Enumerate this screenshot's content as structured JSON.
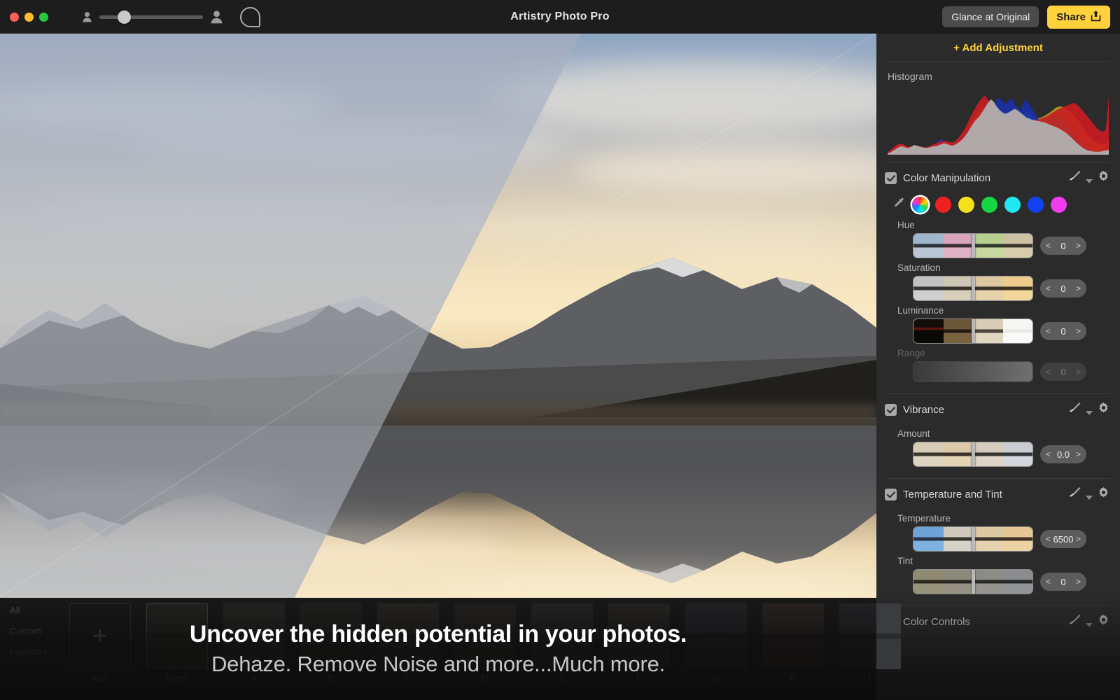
{
  "window": {
    "title": "Artistry Photo Pro",
    "traffic_lights": [
      "close",
      "minimize",
      "maximize"
    ],
    "zoom_slider": {
      "icon_small": "person-small-icon",
      "icon_large": "person-large-icon",
      "value_pct": 18
    },
    "brush_tool_icon": "brush-circle-icon",
    "glance_button": "Glance at Original",
    "share_button": "Share",
    "share_icon": "share-icon"
  },
  "panel": {
    "add_adjustment": "+ Add Adjustment",
    "histogram_label": "Histogram",
    "sections": [
      {
        "title": "Color Manipulation",
        "checked": true,
        "brush_icon": "brush-icon",
        "caret_icon": "chevron-down-icon",
        "gear_icon": "gear-icon",
        "eyedropper_icon": "eyedropper-icon",
        "swatches": [
          {
            "name": "color-wheel",
            "color": "conic",
            "selected": true
          },
          {
            "name": "red",
            "color": "#ef2020",
            "selected": false
          },
          {
            "name": "yellow",
            "color": "#f5e01a",
            "selected": false
          },
          {
            "name": "green",
            "color": "#16d743",
            "selected": false
          },
          {
            "name": "cyan",
            "color": "#20e8f0",
            "selected": false
          },
          {
            "name": "blue",
            "color": "#1342f0",
            "selected": false
          },
          {
            "name": "magenta",
            "color": "#f03cee",
            "selected": false
          }
        ],
        "controls": [
          {
            "label": "Hue",
            "value": "0",
            "dimmed": false
          },
          {
            "label": "Saturation",
            "value": "0",
            "dimmed": false
          },
          {
            "label": "Luminance",
            "value": "0",
            "dimmed": false
          },
          {
            "label": "Range",
            "value": "0",
            "dimmed": true
          }
        ]
      },
      {
        "title": "Vibrance",
        "checked": true,
        "controls": [
          {
            "label": "Amount",
            "value": "0.0",
            "dimmed": false
          }
        ]
      },
      {
        "title": "Temperature and Tint",
        "checked": true,
        "controls": [
          {
            "label": "Temperature",
            "value": "6500",
            "dimmed": false
          },
          {
            "label": "Tint",
            "value": "0",
            "dimmed": true
          }
        ]
      },
      {
        "title": "Color Controls",
        "checked": true,
        "controls": []
      }
    ]
  },
  "filmstrip": {
    "categories": [
      "All",
      "Custom",
      "Favorites"
    ],
    "presets": [
      {
        "name": "Add",
        "kind": "add",
        "selected": false
      },
      {
        "name": "None",
        "kind": "thumb",
        "selected": true
      },
      {
        "name": "A",
        "kind": "thumb",
        "selected": false
      },
      {
        "name": "B",
        "kind": "thumb",
        "selected": false,
        "marked": true
      },
      {
        "name": "C",
        "kind": "thumb",
        "selected": false
      },
      {
        "name": "D",
        "kind": "thumb",
        "selected": false
      },
      {
        "name": "E",
        "kind": "thumb",
        "selected": false
      },
      {
        "name": "F",
        "kind": "thumb",
        "selected": false
      },
      {
        "name": "G",
        "kind": "thumb",
        "selected": false
      },
      {
        "name": "H",
        "kind": "thumb",
        "selected": false
      },
      {
        "name": "I",
        "kind": "thumb",
        "selected": false
      }
    ]
  },
  "overlay": {
    "headline": "Uncover the hidden potential in your photos.",
    "subline": "Dehaze. Remove Noise and more...Much more."
  },
  "colors": {
    "accent": "#ffd23c",
    "panel_bg": "#2b2b2b",
    "titlebar_bg": "#1d1d1d",
    "text": "#d8d8d8"
  },
  "chart_data": {
    "type": "area",
    "title": "Histogram",
    "xlabel": "",
    "ylabel": "",
    "xlim": [
      0,
      255
    ],
    "ylim": [
      0,
      100
    ],
    "grid": false,
    "legend": "none",
    "series": [
      {
        "name": "Luminance",
        "color": "#b0b0b0",
        "values": [
          2,
          4,
          7,
          10,
          13,
          14,
          12,
          11,
          13,
          16,
          15,
          13,
          12,
          11,
          12,
          13,
          14,
          15,
          17,
          19,
          18,
          16,
          15,
          17,
          20,
          24,
          29,
          36,
          44,
          52,
          58,
          63,
          70,
          78,
          86,
          92,
          88,
          80,
          74,
          70,
          68,
          70,
          73,
          76,
          74,
          70,
          66,
          62,
          60,
          58,
          57,
          56,
          55,
          54,
          52,
          50,
          48,
          46,
          44,
          41,
          38,
          34,
          30,
          25,
          20,
          16,
          12,
          9,
          7,
          6,
          5,
          5,
          5,
          6,
          7,
          8
        ]
      },
      {
        "name": "Blue",
        "color": "#1b2ea8",
        "values": [
          3,
          6,
          9,
          12,
          14,
          15,
          12,
          10,
          11,
          13,
          12,
          11,
          10,
          9,
          10,
          12,
          16,
          22,
          26,
          24,
          20,
          18,
          17,
          20,
          26,
          31,
          36,
          42,
          48,
          54,
          58,
          62,
          72,
          84,
          88,
          80,
          70,
          92,
          95,
          88,
          84,
          90,
          94,
          86,
          78,
          74,
          86,
          92,
          84,
          76,
          68,
          60,
          52,
          46,
          42,
          38,
          34,
          30,
          26,
          22,
          18,
          15,
          12,
          9,
          7,
          5,
          4,
          3,
          3,
          2,
          2,
          2,
          2,
          3,
          3,
          4
        ]
      },
      {
        "name": "Green",
        "color": "#18b04a",
        "values": [
          2,
          5,
          8,
          11,
          13,
          14,
          12,
          11,
          12,
          14,
          14,
          13,
          12,
          11,
          13,
          15,
          17,
          19,
          20,
          19,
          17,
          16,
          16,
          18,
          22,
          27,
          33,
          40,
          47,
          55,
          60,
          66,
          74,
          82,
          86,
          84,
          80,
          76,
          72,
          70,
          69,
          71,
          74,
          77,
          76,
          72,
          68,
          64,
          61,
          59,
          58,
          57,
          57,
          58,
          60,
          63,
          66,
          68,
          66,
          62,
          56,
          50,
          44,
          38,
          32,
          26,
          20,
          15,
          11,
          9,
          7,
          6,
          6,
          7,
          8,
          9
        ]
      },
      {
        "name": "Cyan",
        "color": "#1fb6a6",
        "values": [
          1,
          3,
          5,
          8,
          10,
          12,
          11,
          10,
          11,
          13,
          13,
          12,
          11,
          10,
          12,
          14,
          15,
          16,
          17,
          17,
          16,
          15,
          15,
          17,
          20,
          24,
          28,
          33,
          38,
          43,
          47,
          51,
          56,
          62,
          66,
          68,
          70,
          72,
          74,
          70,
          66,
          68,
          72,
          70,
          66,
          62,
          66,
          70,
          68,
          64,
          58,
          52,
          46,
          40,
          35,
          30,
          26,
          22,
          19,
          16,
          13,
          10,
          8,
          6,
          5,
          4,
          3,
          3,
          2,
          2,
          2,
          2,
          2,
          3,
          3,
          4
        ]
      },
      {
        "name": "Red",
        "color": "#cc1c22",
        "values": [
          4,
          8,
          12,
          16,
          18,
          18,
          15,
          13,
          14,
          16,
          15,
          14,
          13,
          12,
          14,
          16,
          18,
          20,
          22,
          23,
          22,
          21,
          20,
          23,
          28,
          34,
          42,
          52,
          62,
          72,
          80,
          88,
          94,
          98,
          92,
          84,
          76,
          70,
          66,
          64,
          63,
          65,
          68,
          70,
          69,
          66,
          63,
          60,
          58,
          57,
          57,
          58,
          60,
          62,
          64,
          67,
          70,
          73,
          76,
          78,
          80,
          82,
          84,
          86,
          84,
          80,
          74,
          68,
          62,
          56,
          50,
          44,
          40,
          38,
          42,
          96
        ]
      },
      {
        "name": "Yellow",
        "color": "#b3a020",
        "values": [
          3,
          6,
          10,
          14,
          16,
          17,
          14,
          12,
          13,
          15,
          15,
          14,
          13,
          12,
          13,
          15,
          17,
          19,
          20,
          20,
          19,
          18,
          18,
          20,
          24,
          29,
          35,
          43,
          51,
          59,
          65,
          70,
          76,
          82,
          84,
          80,
          75,
          71,
          68,
          66,
          65,
          67,
          70,
          72,
          71,
          68,
          65,
          62,
          60,
          59,
          59,
          60,
          62,
          64,
          67,
          70,
          74,
          78,
          80,
          80,
          78,
          74,
          70,
          66,
          60,
          54,
          46,
          38,
          32,
          27,
          23,
          20,
          18,
          17,
          19,
          24
        ]
      }
    ]
  }
}
